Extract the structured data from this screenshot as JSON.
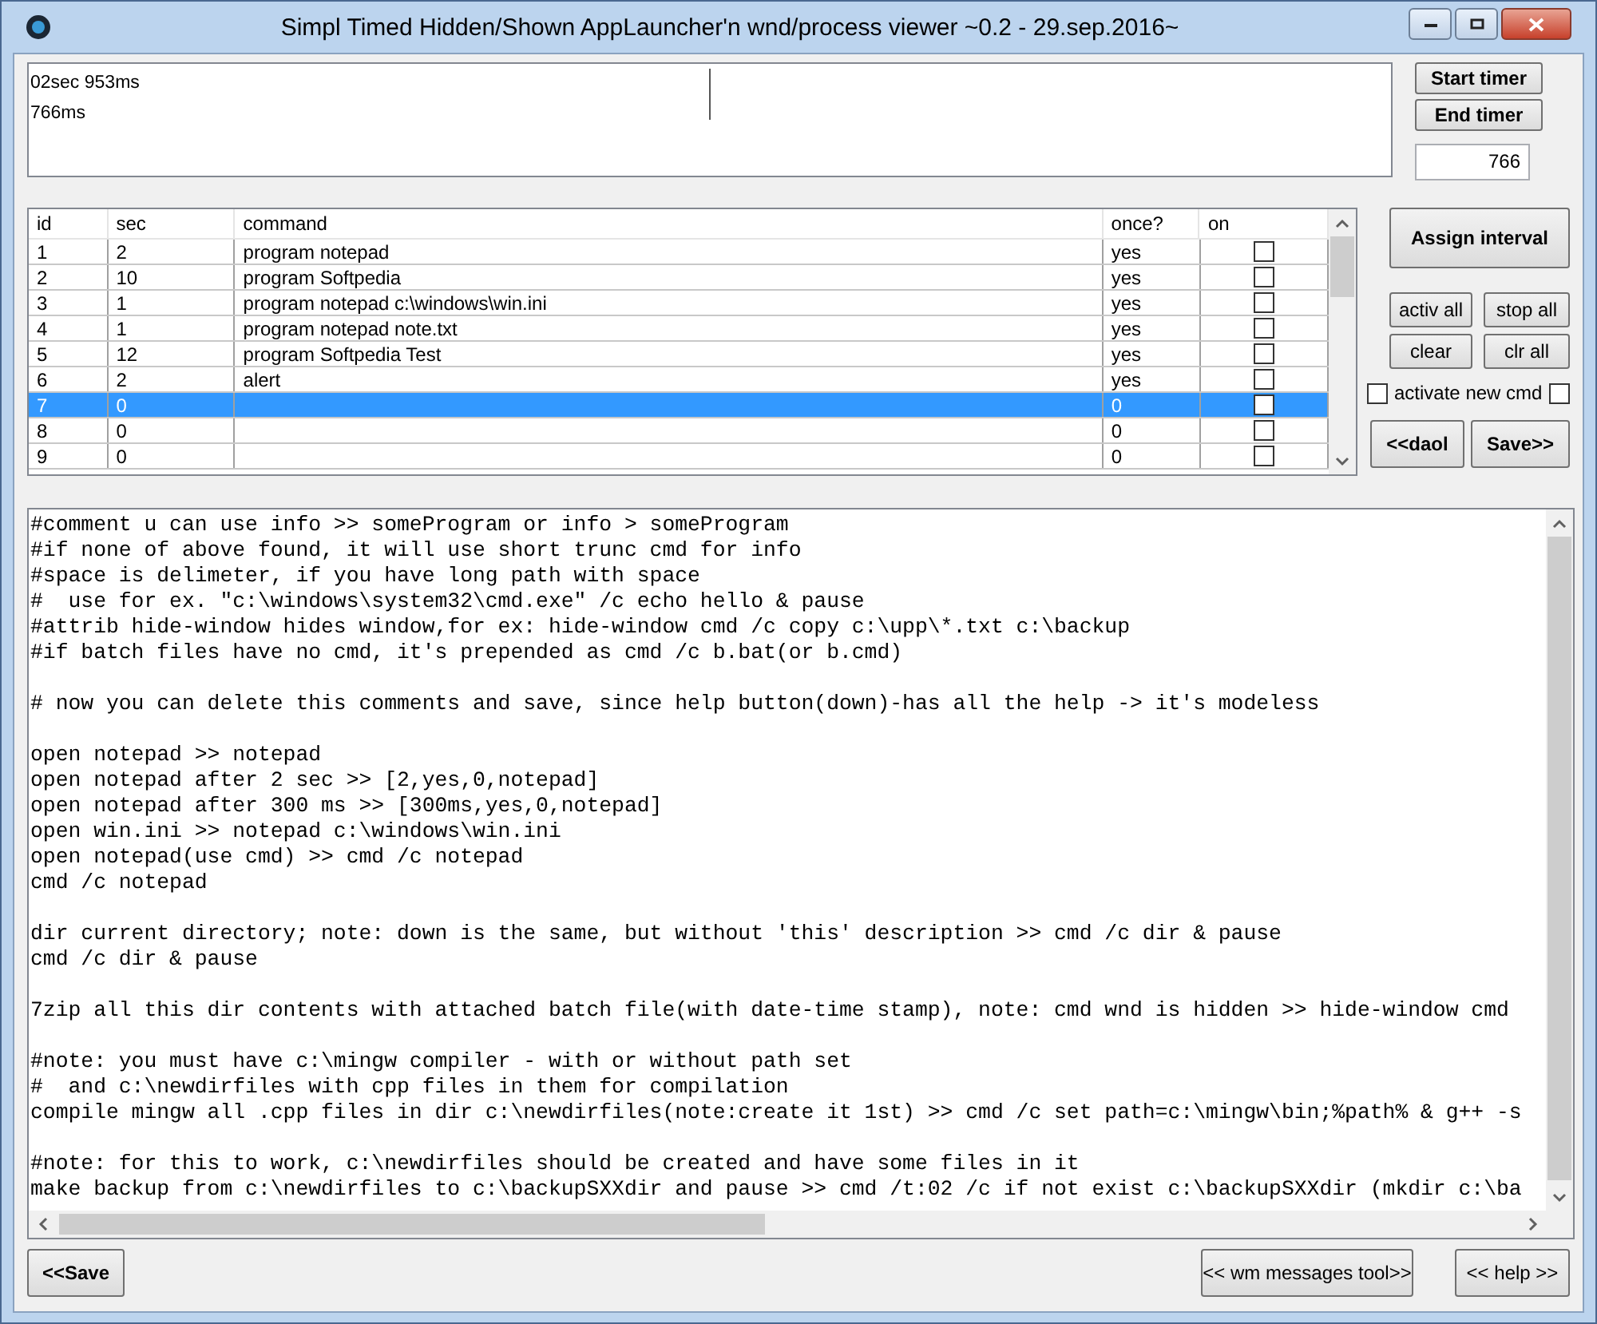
{
  "window": {
    "title": "Simpl Timed Hidden/Shown AppLauncher'n wnd/process viewer ~0.2 - 29.sep.2016~"
  },
  "log": {
    "lines": [
      "02sec 953ms",
      "766ms"
    ]
  },
  "timer": {
    "buttons": [
      "Start timer",
      "End timer"
    ],
    "value": "766"
  },
  "table": {
    "columns": [
      "id",
      "sec",
      "command",
      "once?",
      "on"
    ],
    "rows": [
      {
        "id": "1",
        "sec": "2",
        "command": "program notepad",
        "once": "yes",
        "on": false,
        "selected": false
      },
      {
        "id": "2",
        "sec": "10",
        "command": "program Softpedia",
        "once": "yes",
        "on": false,
        "selected": false
      },
      {
        "id": "3",
        "sec": "1",
        "command": "program notepad c:\\windows\\win.ini",
        "once": "yes",
        "on": false,
        "selected": false
      },
      {
        "id": "4",
        "sec": "1",
        "command": "program notepad note.txt",
        "once": "yes",
        "on": false,
        "selected": false
      },
      {
        "id": "5",
        "sec": "12",
        "command": "program Softpedia Test",
        "once": "yes",
        "on": false,
        "selected": false
      },
      {
        "id": "6",
        "sec": "2",
        "command": "alert",
        "once": "yes",
        "on": false,
        "selected": false
      },
      {
        "id": "7",
        "sec": "0",
        "command": "",
        "once": "0",
        "on": false,
        "selected": true
      },
      {
        "id": "8",
        "sec": "0",
        "command": "",
        "once": "0",
        "on": false,
        "selected": false
      },
      {
        "id": "9",
        "sec": "0",
        "command": "",
        "once": "0",
        "on": false,
        "selected": false
      }
    ]
  },
  "side": {
    "assign": "Assign interval",
    "activ_all": "activ all",
    "stop_all": "stop all",
    "clear": "clear",
    "clr_all": "clr all",
    "activate_new_cmd": {
      "label": "activate new cmd",
      "checked": false
    },
    "extra_checkbox": {
      "checked": false
    },
    "load": "<<daol",
    "save": "Save>>"
  },
  "editor": {
    "paragraphs": [
      [
        "#comment u can use info >> someProgram or info > someProgram",
        "#if none of above found, it will use short trunc cmd for info",
        "#space is delimeter, if you have long path with space",
        "#  use for ex. \"c:\\windows\\system32\\cmd.exe\" /c echo hello & pause",
        "#attrib hide-window hides window,for ex: hide-window cmd /c copy c:\\upp\\*.txt c:\\backup",
        "#if batch files have no cmd, it's prepended as cmd /c b.bat(or b.cmd)"
      ],
      [
        "# now you can delete this comments and save, since help button(down)-has all the help -> it's modeless"
      ],
      [
        "open notepad >> notepad",
        "open notepad after 2 sec >> [2,yes,0,notepad]",
        "open notepad after 300 ms >> [300ms,yes,0,notepad]",
        "open win.ini >> notepad c:\\windows\\win.ini",
        "open notepad(use cmd) >> cmd /c notepad",
        "cmd /c notepad"
      ],
      [
        "dir current directory; note: down is the same, but without 'this' description >> cmd /c dir & pause",
        "cmd /c dir & pause"
      ],
      [
        "7zip all this dir contents with attached batch file(with date-time stamp), note: cmd wnd is hidden >> hide-window cmd"
      ],
      [
        "#note: you must have c:\\mingw compiler - with or without path set",
        "#  and c:\\newdirfiles with cpp files in them for compilation",
        "compile mingw all .cpp files in dir c:\\newdirfiles(note:create it 1st) >> cmd /c set path=c:\\mingw\\bin;%path% & g++ -s"
      ],
      [
        "#note: for this to work, c:\\newdirfiles should be created and have some files in it",
        "make backup from c:\\newdirfiles to c:\\backupSXXdir and pause >> cmd /t:02 /c if not exist c:\\backupSXXdir (mkdir c:\\ba"
      ]
    ]
  },
  "footer": {
    "save": "<<Save",
    "wm": "<< wm messages tool>>",
    "help": "<< help >>"
  }
}
